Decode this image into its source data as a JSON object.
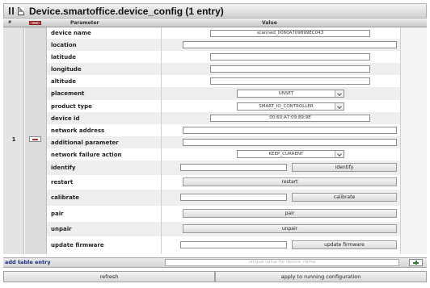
{
  "window": {
    "title": "Device.smartoffice.device_config (1 entry)"
  },
  "table": {
    "headers": {
      "index": "#",
      "parameter": "Parameter",
      "value": "Value"
    },
    "row_index": "1",
    "params": [
      {
        "key": "device_name",
        "label": "device name",
        "value": "scanned_0060A709899EC043"
      },
      {
        "key": "location",
        "label": "location",
        "value": ""
      },
      {
        "key": "latitude",
        "label": "latitude",
        "value": ""
      },
      {
        "key": "longitude",
        "label": "longitude",
        "value": ""
      },
      {
        "key": "altitude",
        "label": "altitude",
        "value": ""
      },
      {
        "key": "placement",
        "label": "placement",
        "value": "UNSET"
      },
      {
        "key": "product_type",
        "label": "product type",
        "value": "SMART_IO_CONTROLLER"
      },
      {
        "key": "device_id",
        "label": "device id",
        "value": "00:60:A7:09:89:9E"
      },
      {
        "key": "network_address",
        "label": "network address",
        "value": ""
      },
      {
        "key": "additional_parameter",
        "label": "additional parameter",
        "value": ""
      },
      {
        "key": "network_failure_action",
        "label": "network failure action",
        "value": "KEEP_CURRENT"
      },
      {
        "key": "identify",
        "label": "identify",
        "value": "",
        "button": "identify"
      },
      {
        "key": "restart",
        "label": "restart",
        "button": "restart"
      },
      {
        "key": "calibrate",
        "label": "calibrate",
        "value": "",
        "button": "calibrate"
      },
      {
        "key": "pair",
        "label": "pair",
        "button": "pair"
      },
      {
        "key": "unpair",
        "label": "unpair",
        "button": "unpair"
      },
      {
        "key": "update_firmware",
        "label": "update firmware",
        "value": "",
        "button": "update firmware"
      }
    ]
  },
  "add_entry": {
    "label": "add table entry",
    "placeholder": "unique value for device_name"
  },
  "footer": {
    "refresh": "refresh",
    "apply": "apply to running configuration"
  },
  "icons": {
    "pause": "pause-icon",
    "document": "document-icon",
    "remove": "minus-icon",
    "add": "plus-icon",
    "dropdown": "chevron-down-icon"
  },
  "colors": {
    "remove": "#c24b4b",
    "add": "#1f8a2a",
    "add_label": "#1b2f80"
  }
}
